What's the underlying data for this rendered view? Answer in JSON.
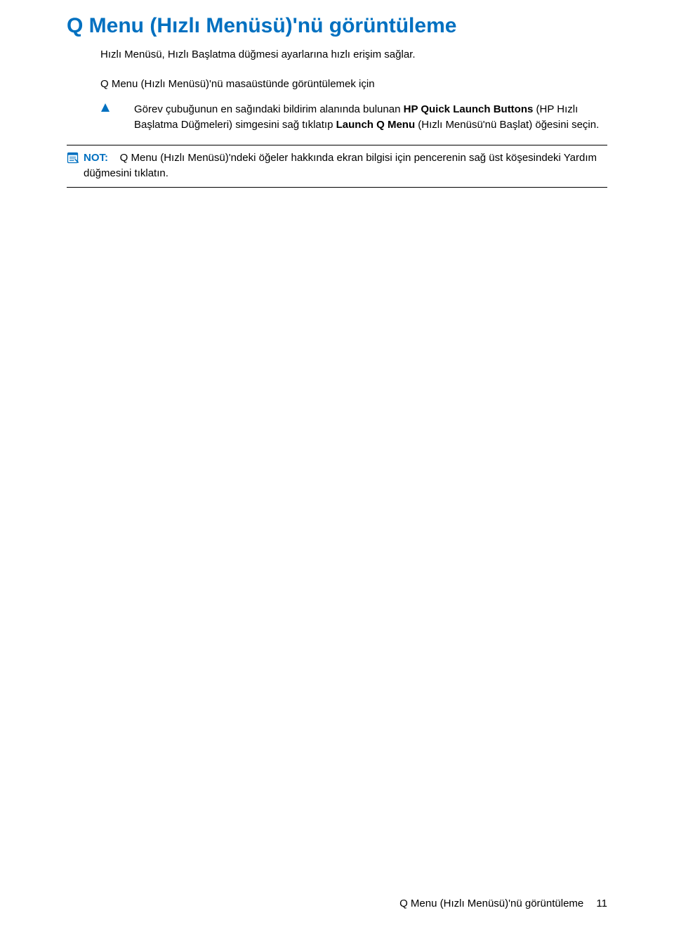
{
  "h1": "Q Menu (Hızlı Menüsü)'nü görüntüleme",
  "subtitle": "Hızlı Menüsü, Hızlı Başlatma düğmesi ayarlarına hızlı erişim sağlar.",
  "para1": "Q Menu (Hızlı Menüsü)'nü masaüstünde görüntülemek için",
  "step": {
    "pre": "Görev çubuğunun en sağındaki bildirim alanında bulunan ",
    "bold1": "HP Quick Launch Buttons",
    "mid": " (HP Hızlı Başlatma Düğmeleri) simgesini sağ tıklatıp ",
    "bold2": "Launch Q Menu",
    "post": " (Hızlı Menüsü'nü Başlat) öğesini seçin."
  },
  "note": {
    "label": "NOT:",
    "text": "Q Menu (Hızlı Menüsü)'ndeki öğeler hakkında ekran bilgisi için pencerenin sağ üst köşesindeki Yardım düğmesini tıklatın."
  },
  "footer": {
    "title": "Q Menu (Hızlı Menüsü)'nü görüntüleme",
    "page": "11"
  }
}
